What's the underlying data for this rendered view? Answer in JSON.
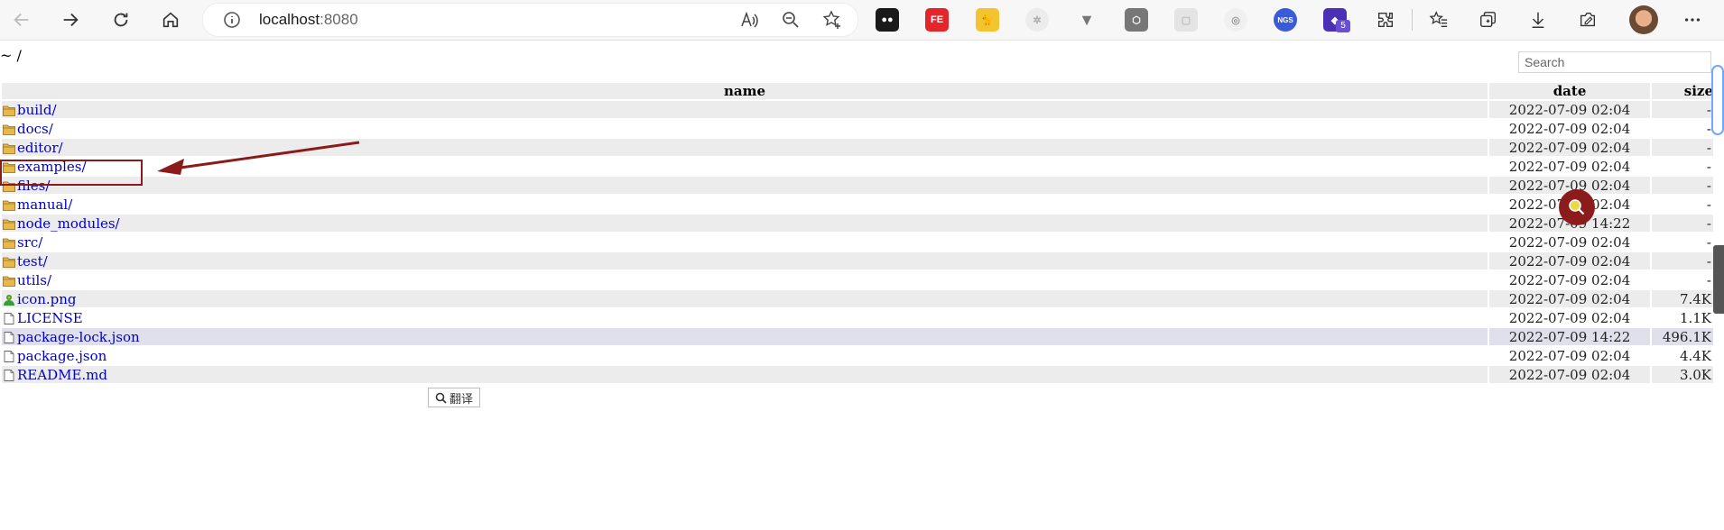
{
  "browser": {
    "address": {
      "host": "localhost",
      "port": ":8080"
    },
    "badge_count": "5"
  },
  "page": {
    "breadcrumb": "~ /",
    "search_placeholder": "Search",
    "columns": {
      "name": "name",
      "date": "date",
      "size": "size"
    },
    "files": [
      {
        "name": "build/",
        "date": "2022-07-09 02:04",
        "size": "-",
        "type": "folder"
      },
      {
        "name": "docs/",
        "date": "2022-07-09 02:04",
        "size": "-",
        "type": "folder"
      },
      {
        "name": "editor/",
        "date": "2022-07-09 02:04",
        "size": "-",
        "type": "folder"
      },
      {
        "name": "examples/",
        "date": "2022-07-09 02:04",
        "size": "-",
        "type": "folder"
      },
      {
        "name": "files/",
        "date": "2022-07-09 02:04",
        "size": "-",
        "type": "folder"
      },
      {
        "name": "manual/",
        "date": "2022-07-09 02:04",
        "size": "-",
        "type": "folder"
      },
      {
        "name": "node_modules/",
        "date": "2022-07-09 14:22",
        "size": "-",
        "type": "folder"
      },
      {
        "name": "src/",
        "date": "2022-07-09 02:04",
        "size": "-",
        "type": "folder"
      },
      {
        "name": "test/",
        "date": "2022-07-09 02:04",
        "size": "-",
        "type": "folder"
      },
      {
        "name": "utils/",
        "date": "2022-07-09 02:04",
        "size": "-",
        "type": "folder"
      },
      {
        "name": "icon.png",
        "date": "2022-07-09 02:04",
        "size": "7.4K",
        "type": "image"
      },
      {
        "name": "LICENSE",
        "date": "2022-07-09 02:04",
        "size": "1.1K",
        "type": "file"
      },
      {
        "name": "package-lock.json",
        "date": "2022-07-09 14:22",
        "size": "496.1K",
        "type": "file"
      },
      {
        "name": "package.json",
        "date": "2022-07-09 02:04",
        "size": "4.4K",
        "type": "file"
      },
      {
        "name": "README.md",
        "date": "2022-07-09 02:04",
        "size": "3.0K",
        "type": "file"
      }
    ]
  },
  "overlay": {
    "translate_label": "翻译"
  },
  "colors": {
    "link": "#0000cc",
    "annotation": "#8b1a1a",
    "folder": "#e8b84a"
  }
}
